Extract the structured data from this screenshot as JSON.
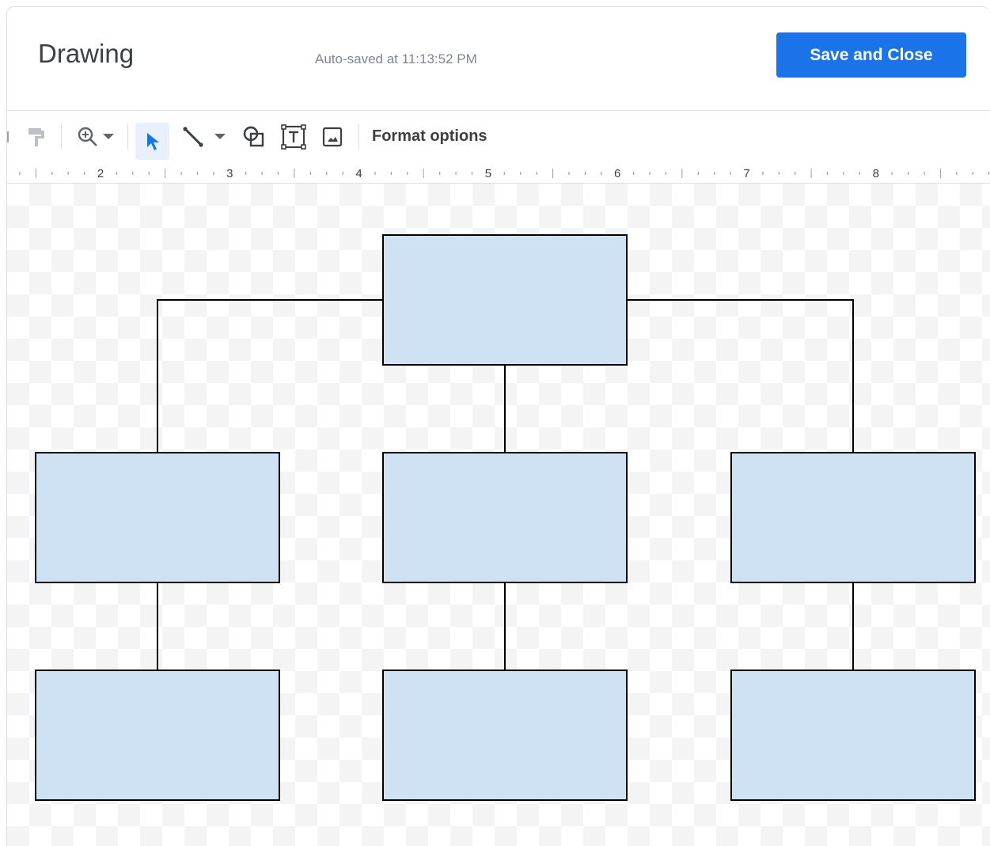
{
  "dialog": {
    "title": "Drawing",
    "autosave_text": "Auto-saved at 11:13:52 PM",
    "save_button_label": "Save and Close"
  },
  "toolbar": {
    "items": [
      {
        "name": "paint-format-icon"
      },
      {
        "name": "zoom-icon"
      },
      {
        "name": "select-arrow-icon",
        "active": true
      },
      {
        "name": "line-icon"
      },
      {
        "name": "shape-icon"
      },
      {
        "name": "text-box-icon"
      },
      {
        "name": "image-icon"
      }
    ],
    "format_options_label": "Format options"
  },
  "ruler": {
    "labels": [
      "2",
      "3",
      "4",
      "5",
      "6",
      "7",
      "8"
    ]
  },
  "diagram": {
    "shape_fill": "#cfe2f3",
    "shape_stroke": "#000000",
    "boxes": [
      {
        "id": "root"
      },
      {
        "id": "level2-left"
      },
      {
        "id": "level2-center"
      },
      {
        "id": "level2-right"
      },
      {
        "id": "level3-left"
      },
      {
        "id": "level3-center"
      },
      {
        "id": "level3-right"
      }
    ]
  },
  "colors": {
    "accent": "#1a73e8",
    "active_tool_bg": "#e8f0fe"
  }
}
